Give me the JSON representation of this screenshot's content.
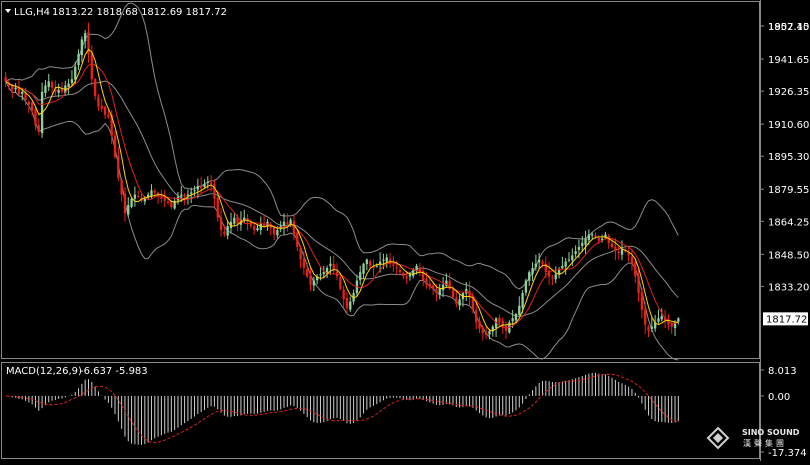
{
  "header": {
    "symbol": "LLG,H4",
    "ohlc": "1813.22 1818.68 1812.69 1817.72",
    "macd_label": "MACD(12,26,9)",
    "macd_values": "-6.637 -5.983"
  },
  "price_axis": {
    "ticks": [
      "1957.40",
      "1941.65",
      "1926.35",
      "1910.60",
      "1895.30",
      "1879.55",
      "1864.25",
      "1848.50",
      "1833.20",
      "1817.72",
      "1802.15"
    ],
    "tick_values": [
      1957.4,
      1941.65,
      1926.35,
      1910.6,
      1895.3,
      1879.55,
      1864.25,
      1848.5,
      1833.2,
      1802.15
    ],
    "current_price": "1817.72",
    "current_value": 1817.72
  },
  "macd_axis": {
    "ticks": [
      "8.013",
      "0.00",
      "-17.374"
    ],
    "tick_values": [
      8.013,
      0.0,
      -17.374
    ]
  },
  "watermark": {
    "brand": "SINO SOUND",
    "brand_cn": "漢聲集團"
  },
  "colors": {
    "background": "#000000",
    "bull": "#8fd19e",
    "bear": "#e8221b",
    "ma": "#ffd400",
    "ma2": "#e02020",
    "bands": "#8c8c8c",
    "signal": "#e02020",
    "hist": "#cfcfcf",
    "axis_text": "#ffffff"
  },
  "chart_data": {
    "type": "candlestick",
    "timeframe": "H4",
    "ylim": [
      1800,
      1966
    ],
    "close": [
      1931,
      1929,
      1927,
      1928,
      1925,
      1926,
      1922,
      1920,
      1917,
      1910,
      1907,
      1926,
      1929,
      1931,
      1928,
      1926,
      1927,
      1926,
      1929,
      1930,
      1932,
      1938,
      1944,
      1951,
      1954,
      1944,
      1932,
      1924,
      1919,
      1918,
      1915,
      1914,
      1905,
      1895,
      1885,
      1877,
      1868,
      1872,
      1875,
      1877,
      1876,
      1874,
      1875,
      1877,
      1879,
      1878,
      1876,
      1875,
      1874,
      1873,
      1871,
      1874,
      1876,
      1877,
      1876,
      1877,
      1878,
      1879,
      1881,
      1880,
      1882,
      1883,
      1882,
      1875,
      1866,
      1860,
      1858,
      1862,
      1864,
      1866,
      1863,
      1865,
      1866,
      1864,
      1862,
      1860,
      1861,
      1863,
      1862,
      1864,
      1861,
      1858,
      1860,
      1862,
      1864,
      1863,
      1865,
      1858,
      1852,
      1846,
      1842,
      1838,
      1834,
      1836,
      1838,
      1839,
      1840,
      1842,
      1844,
      1841,
      1838,
      1832,
      1827,
      1823,
      1826,
      1830,
      1836,
      1840,
      1844,
      1846,
      1843,
      1842,
      1843,
      1845,
      1846,
      1847,
      1844,
      1843,
      1842,
      1840,
      1838,
      1837,
      1839,
      1841,
      1843,
      1840,
      1836,
      1834,
      1833,
      1832,
      1830,
      1832,
      1834,
      1836,
      1832,
      1828,
      1825,
      1827,
      1830,
      1832,
      1828,
      1822,
      1816,
      1813,
      1811,
      1810,
      1812,
      1814,
      1818,
      1816,
      1814,
      1812,
      1816,
      1818,
      1820,
      1824,
      1830,
      1836,
      1840,
      1842,
      1844,
      1846,
      1844,
      1840,
      1838,
      1837,
      1839,
      1841,
      1843,
      1845,
      1846,
      1848,
      1850,
      1852,
      1854,
      1856,
      1858,
      1858,
      1857,
      1855,
      1856,
      1858,
      1854,
      1852,
      1850,
      1849,
      1851,
      1850,
      1848,
      1844,
      1838,
      1830,
      1822,
      1815,
      1812,
      1814,
      1816,
      1818,
      1819,
      1817,
      1815,
      1814,
      1816,
      1818
    ]
  }
}
